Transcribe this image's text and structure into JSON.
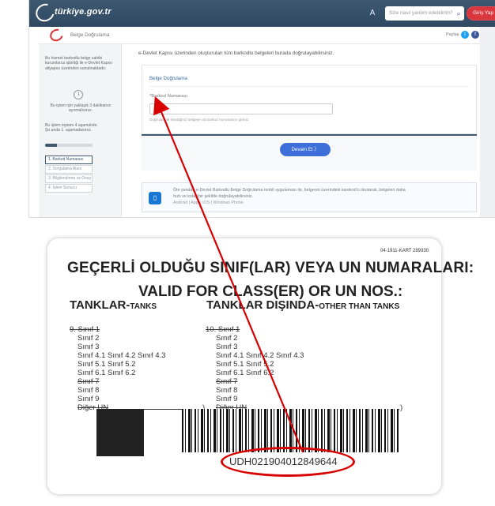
{
  "window": {
    "logo_text": "türkiye.gov.tr",
    "search_placeholder": "Size nasıl yardım edebilirim?",
    "search_icon": "search-icon",
    "login_label": "Giriş Yap",
    "accessibility_label": "A"
  },
  "service": {
    "title": "Belge Doğrulama",
    "share_label": "Paylaş",
    "twitter_icon": "twitter-icon",
    "facebook_icon": "facebook-icon"
  },
  "sidebar": {
    "info_text": "Bu hizmet barkodlu belge sahibi kurumlarca işbirliği ile e-Devlet Kapısı altyapısı üzerinden sunulmaktadır.",
    "time_text": "Bu işlem için yaklaşık 3 dakikanızı ayırmalısınız.",
    "steps_total_text": "Bu işlem toplam 4 aşamalıdır.",
    "current_step_text": "Şu anda 1. aşamadasınız.",
    "progress": 0.25,
    "steps": [
      "1. Barkod Numarası",
      "2. Sorgulama Alanı",
      "3. Bilgilendirme ve Onay",
      "4. İşlem Sonucu"
    ]
  },
  "main": {
    "intro": "e-Devlet Kapısı üzerinden oluşturulan tüm barkodlu belgeleri burada doğrulayabilirsiniz.",
    "form_title": "Belge Doğrulama",
    "field_label": "*Barkod Numarası",
    "field_help": "Doğrulamak istediğiniz belgeye ait barkod numarasını giriniz.",
    "continue_label": "Devam Et",
    "app_text_line1": "Öte yandan e-Devlet Barkodlu Belge Doğrulama mobil uygulaması ile, belgenin üzerindeki karekod'u okutarak, belgeleri daha",
    "app_text_line2": "hızlı ve kolay bir şekilde doğrulayabilirsiniz.",
    "app_links": "Android | Apple iOS | Windows Phone"
  },
  "card": {
    "number": "04-1911-KART 289330",
    "heading_line1": "GEÇERLİ OLDUĞU SINIF(LAR) VEYA UN NUMARALARI:",
    "heading_line2": "VALID FOR CLASS(ER) OR UN NOS.:",
    "tanks_label": "TANKLAR-",
    "tanks_label_en": "TANKS",
    "other_label": "TANKLAR DIŞINDA-",
    "other_label_en": "OTHER THAN TANKS",
    "left_column": [
      "9. Sınıf 1",
      "Sınıf 2",
      "Sınıf 3",
      "Sınıf 4.1   Sınıf 4.2   Sınıf 4.3",
      "Sınıf 5.1   Sınıf 5.2",
      "Sınıf 6.1   Sınıf 6.2",
      "Sınıf 7",
      "Sınıf 8",
      "Sınıf 9",
      "Diğer UN"
    ],
    "right_column": [
      "10. Sınıf 1",
      "Sınıf 2",
      "Sınıf 3",
      "Sınıf 4.1   Sınıf 4.2   Sınıf 4.3",
      "Sınıf 5.1   Sınıf 5.2",
      "Sınıf 6.1   Sınıf 6.2",
      "Sınıf 7",
      "Sınıf 8",
      "Sınıf 9",
      "Diğer UN"
    ],
    "barcode_number": "UDH021904012849644"
  },
  "colors": {
    "accent": "#3e6fd8",
    "annotation": "#d80000",
    "header": "#3e5870"
  }
}
